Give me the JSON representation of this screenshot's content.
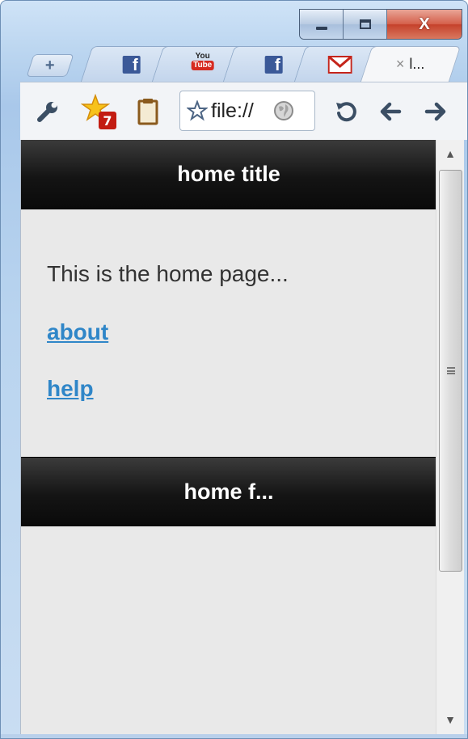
{
  "window": {
    "caption_buttons": [
      "minimize",
      "maximize",
      "close"
    ]
  },
  "tabs": [
    {
      "icon": "facebook-icon",
      "glyph": "f"
    },
    {
      "icon": "youtube-icon",
      "you": "You",
      "tube": "Tube"
    },
    {
      "icon": "facebook-icon",
      "glyph": "f"
    },
    {
      "icon": "gmail-icon"
    },
    {
      "icon": "close-icon",
      "close": "×",
      "title": "l..."
    }
  ],
  "new_tab": {
    "label": "+"
  },
  "toolbar": {
    "extension_badge": "7",
    "address": "file://"
  },
  "page": {
    "header_title": "home title",
    "body_text": "This is the home page...",
    "links": [
      "about",
      "help"
    ],
    "footer_title": "home f..."
  },
  "colors": {
    "header_bg": "#141414",
    "link": "#2f86c8",
    "page_bg": "#e9e9e9"
  }
}
